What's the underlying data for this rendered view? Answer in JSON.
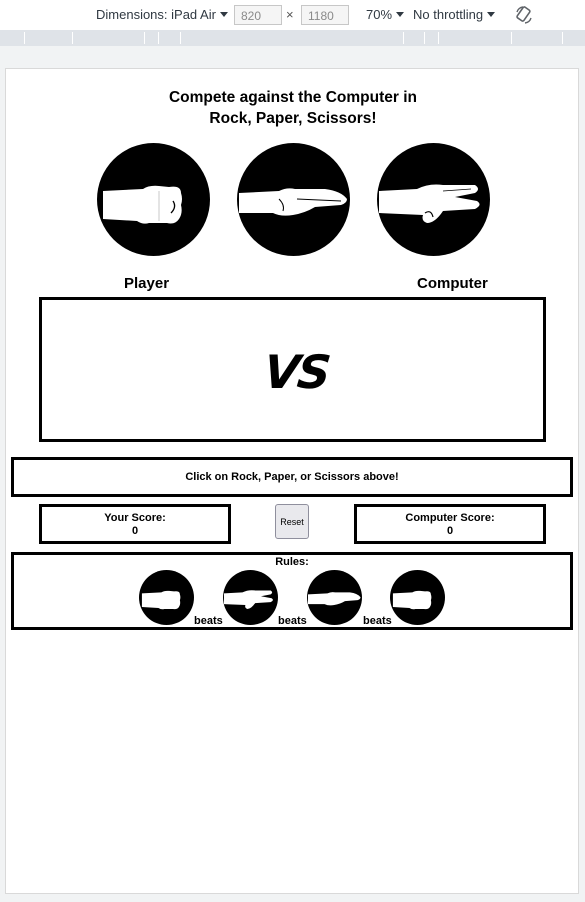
{
  "devtools": {
    "dimensions_label": "Dimensions: iPad Air",
    "width": "820",
    "height": "1180",
    "times": "×",
    "zoom": "70%",
    "throttling": "No throttling"
  },
  "game": {
    "title_line1": "Compete against the Computer in",
    "title_line2": "Rock, Paper, Scissors!",
    "choices": [
      {
        "name": "Rock",
        "icon": "rock-hand-icon"
      },
      {
        "name": "Paper",
        "icon": "paper-hand-icon"
      },
      {
        "name": "Scissors",
        "icon": "scissors-hand-icon"
      }
    ],
    "player_label": "Player",
    "computer_label": "Computer",
    "vs_text": "VS",
    "message": "Click on Rock, Paper, or Scissors above!",
    "your_score_label": "Your Score:",
    "your_score": "0",
    "computer_score_label": "Computer Score:",
    "computer_score": "0",
    "reset_label": "Reset",
    "rules_title": "Rules:",
    "rules_sequence": [
      "rock-hand-icon",
      "scissors-hand-icon",
      "paper-hand-icon",
      "rock-hand-icon"
    ],
    "beats_word": "beats"
  },
  "colors": {
    "ink": "#000000",
    "page": "#ffffff",
    "chrome": "#f1f3f4"
  }
}
